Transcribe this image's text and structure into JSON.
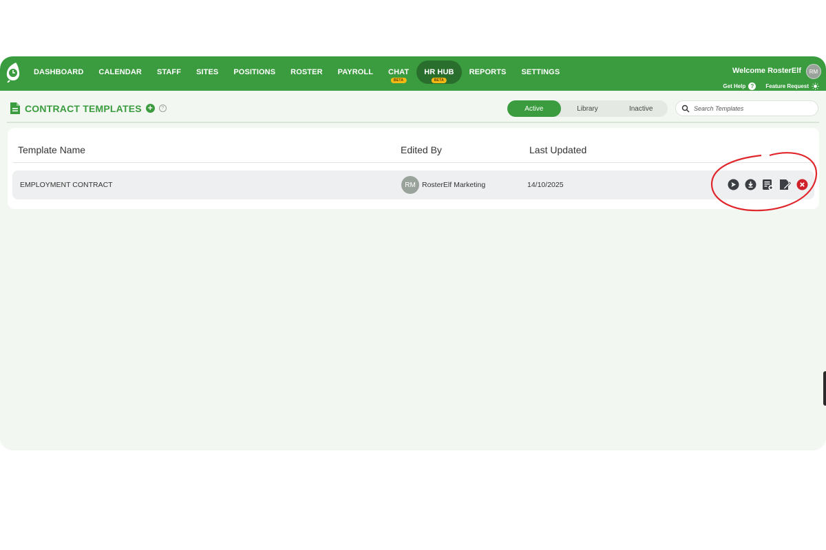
{
  "nav": {
    "items": [
      {
        "label": "DASHBOARD",
        "beta": ""
      },
      {
        "label": "CALENDAR",
        "beta": ""
      },
      {
        "label": "STAFF",
        "beta": ""
      },
      {
        "label": "SITES",
        "beta": ""
      },
      {
        "label": "POSITIONS",
        "beta": ""
      },
      {
        "label": "ROSTER",
        "beta": ""
      },
      {
        "label": "PAYROLL",
        "beta": ""
      },
      {
        "label": "CHAT",
        "beta": "BETA"
      },
      {
        "label": "HR HUB",
        "beta": "BETA"
      },
      {
        "label": "REPORTS",
        "beta": ""
      },
      {
        "label": "SETTINGS",
        "beta": ""
      }
    ],
    "active": "HR HUB"
  },
  "user": {
    "welcome": "Welcome RosterElf",
    "initials": "RM",
    "get_help": "Get Help",
    "feature_request": "Feature Request"
  },
  "page": {
    "title": "CONTRACT TEMPLATES"
  },
  "filters": {
    "tabs": [
      "Active",
      "Library",
      "Inactive"
    ],
    "selected": "Active"
  },
  "search": {
    "placeholder": "Search Templates"
  },
  "table": {
    "columns": [
      "Template Name",
      "Edited By",
      "Last Updated"
    ],
    "rows": [
      {
        "name": "EMPLOYMENT CONTRACT",
        "editor_initials": "RM",
        "editor": "RosterElf Marketing",
        "updated": "14/10/2025"
      }
    ]
  },
  "colors": {
    "brand": "#3a9c3e",
    "brand_dark": "#2a6e2e",
    "beta_badge": "#f5b914",
    "delete": "#d0202a",
    "annotation": "#e0262b"
  },
  "icons": {
    "row_actions": [
      "send-icon",
      "download-icon",
      "add-to-list-icon",
      "edit-document-icon",
      "delete-icon"
    ]
  }
}
